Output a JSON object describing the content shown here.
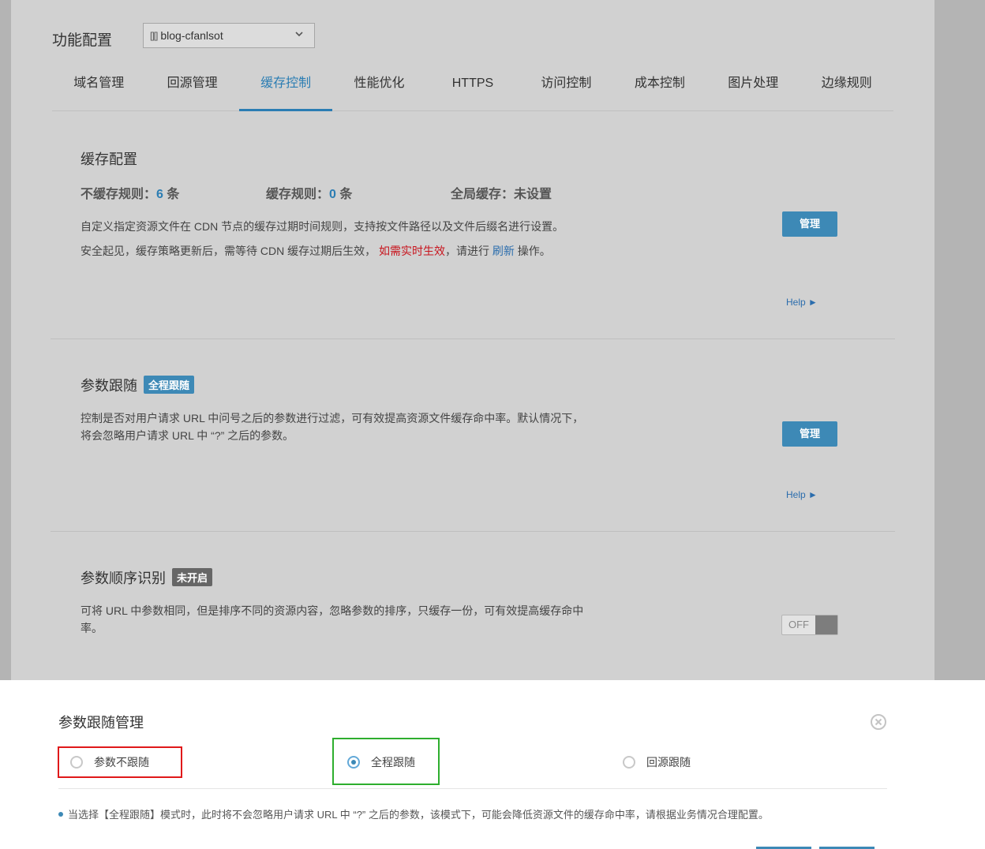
{
  "page": {
    "title": "功能配置",
    "domain_select": {
      "icon": "[][]",
      "value": "blog-cfanlsot"
    }
  },
  "tabs": [
    {
      "label": "域名管理",
      "active": false
    },
    {
      "label": "回源管理",
      "active": false
    },
    {
      "label": "缓存控制",
      "active": true
    },
    {
      "label": "性能优化",
      "active": false
    },
    {
      "label": "HTTPS",
      "active": false
    },
    {
      "label": "访问控制",
      "active": false
    },
    {
      "label": "成本控制",
      "active": false
    },
    {
      "label": "图片处理",
      "active": false
    },
    {
      "label": "边缘规则",
      "active": false
    }
  ],
  "cache_config": {
    "title": "缓存配置",
    "stats": [
      {
        "label": "不缓存规则：",
        "value": "6",
        "unit": " 条"
      },
      {
        "label": "缓存规则：",
        "value": "0",
        "unit": " 条"
      },
      {
        "label": "全局缓存：",
        "value": "未设置",
        "unit": ""
      }
    ],
    "desc_line1": "自定义指定资源文件在 CDN 节点的缓存过期时间规则，支持按文件路径以及文件后缀名进行设置。",
    "desc_line2_a": "安全起见，缓存策略更新后，需等待 CDN 缓存过期后生效，",
    "desc_line2_red": "如需实时生效",
    "desc_line2_b": "，请进行",
    "desc_line2_link": "刷新",
    "desc_line2_c": "操作。",
    "manage_label": "管理",
    "help_label": "Help ►"
  },
  "param_follow": {
    "title": "参数跟随",
    "badge": "全程跟随",
    "desc_line1": "控制是否对用户请求 URL 中问号之后的参数进行过滤，可有效提高资源文件缓存命中率。默认情况下，",
    "desc_line2": "将会忽略用户请求 URL 中 “?” 之后的参数。",
    "manage_label": "管理",
    "help_label": "Help ►"
  },
  "param_order": {
    "title": "参数顺序识别",
    "badge": "未开启",
    "desc_line1": "可将 URL 中参数相同，但是排序不同的资源内容，忽略参数的排序，只缓存一份，可有效提高缓存命中",
    "desc_line2": "率。",
    "toggle_label": "OFF"
  },
  "dialog": {
    "title": "参数跟随管理",
    "options": [
      {
        "label": "参数不跟随",
        "checked": false
      },
      {
        "label": "全程跟随",
        "checked": true
      },
      {
        "label": "回源跟随",
        "checked": false
      }
    ],
    "note": "当选择【全程跟随】模式时，此时将不会忽略用户请求 URL 中 “?” 之后的参数，该模式下，可能会降低资源文件的缓存命中率，请根据业务情况合理配置。"
  }
}
